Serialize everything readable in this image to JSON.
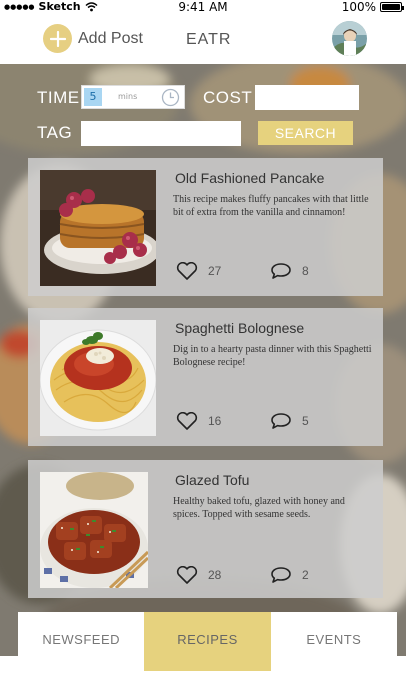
{
  "status_bar": {
    "carrier": "Sketch",
    "time": "9:41 AM",
    "battery": "100%",
    "battery_level": 1.0
  },
  "header": {
    "add_post_label": "Add Post",
    "app_name": "EATR"
  },
  "search": {
    "time_label": "TIME",
    "time_value": "5",
    "time_unit": "mins",
    "cost_label": "COST",
    "cost_value": "",
    "tag_label": "TAG",
    "tag_value": "",
    "search_button": "SEARCH"
  },
  "recipes": [
    {
      "title": "Old Fashioned Pancake",
      "description": "This recipe makes fluffy pancakes with that little bit of extra from the vanilla and cinnamon!",
      "likes": "27",
      "comments": "8",
      "image_icon": "pancake-image"
    },
    {
      "title": "Spaghetti Bolognese",
      "description": "Dig in to a hearty pasta dinner with this Spaghetti Bolognese recipe!",
      "likes": "16",
      "comments": "5",
      "image_icon": "spaghetti-image"
    },
    {
      "title": "Glazed Tofu",
      "description": "Healthy baked tofu, glazed with honey and spices. Topped with sesame seeds.",
      "likes": "28",
      "comments": "2",
      "image_icon": "tofu-image"
    }
  ],
  "tabs": [
    {
      "label": "NEWSFEED",
      "active": false
    },
    {
      "label": "RECIPES",
      "active": true
    },
    {
      "label": "EVENTS",
      "active": false
    }
  ],
  "colors": {
    "accent": "#e6d27e",
    "time_highlight": "#a9d6f2"
  }
}
